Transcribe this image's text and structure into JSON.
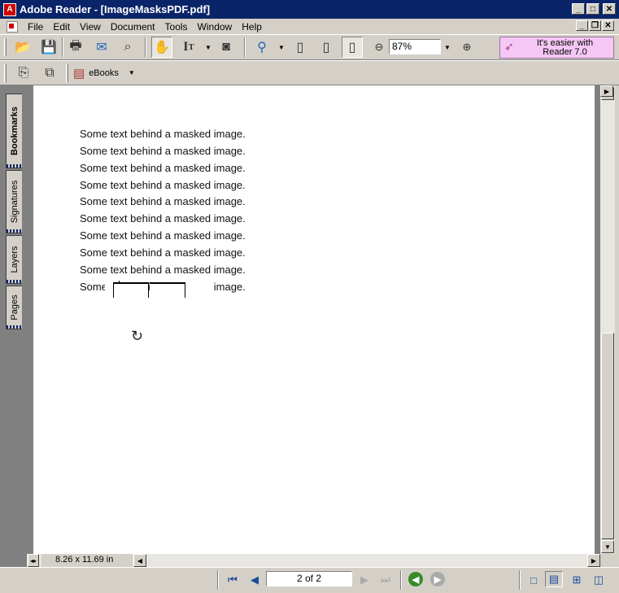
{
  "window": {
    "title": "Adobe Reader - [ImageMasksPDF.pdf]",
    "app_icon_label": "A"
  },
  "menu": [
    "File",
    "Edit",
    "View",
    "Document",
    "Tools",
    "Window",
    "Help"
  ],
  "toolbar": {
    "zoom_value": "87%",
    "promo_text_line1": "It's easier with",
    "promo_text_line2": "Reader 7.0",
    "ebooks_label": "eBooks"
  },
  "nav_tabs": [
    "Bookmarks",
    "Signatures",
    "Layers",
    "Pages"
  ],
  "document": {
    "lines": [
      "Some text behind a masked image.",
      "Some text behind a masked image.",
      "Some text behind a masked image.",
      "Some text behind a masked image.",
      "Some text behind a masked image.",
      "Some text behind a masked image.",
      "Some text behind a masked image.",
      "Some text behind a masked image.",
      "Some text behind a masked image.",
      "Some text behind a masked image."
    ]
  },
  "statusbar": {
    "page_size": "8.26 x 11.69 in",
    "page_indicator": "2 of 2"
  },
  "colors": {
    "titlebar": "#0a246a",
    "promo_bg": "#f5c7f5",
    "chrome": "#d4d0c8"
  },
  "icons": {
    "open": "folder-open-icon",
    "save": "disk-icon",
    "print": "printer-icon",
    "email": "email-globe-icon",
    "search": "binoculars-icon",
    "hand": "hand-icon",
    "select_text": "text-select-icon",
    "snapshot": "camera-icon",
    "zoom_in": "magnifier-icon"
  }
}
